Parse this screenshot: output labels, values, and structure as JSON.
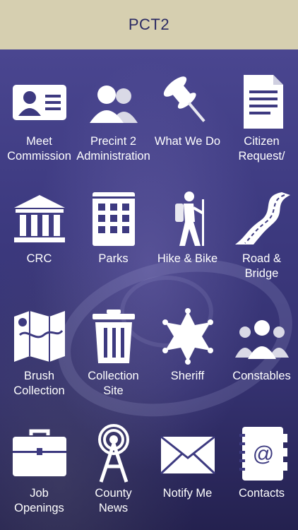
{
  "header": {
    "title": "PCT2"
  },
  "tiles": [
    {
      "label": "Meet\nCommission",
      "icon": "id-card-icon"
    },
    {
      "label": "Precint 2\nAdministration",
      "icon": "people-icon"
    },
    {
      "label": "What We Do",
      "icon": "pushpin-icon"
    },
    {
      "label": "Citizen\nRequest/",
      "icon": "document-icon"
    },
    {
      "label": "CRC",
      "icon": "courthouse-icon"
    },
    {
      "label": "Parks",
      "icon": "building-icon"
    },
    {
      "label": "Hike & Bike",
      "icon": "hiker-icon"
    },
    {
      "label": "Road &\nBridge",
      "icon": "road-icon"
    },
    {
      "label": "Brush\nCollection",
      "icon": "map-icon"
    },
    {
      "label": "Collection\nSite",
      "icon": "trash-can-icon"
    },
    {
      "label": "Sheriff",
      "icon": "star-badge-icon"
    },
    {
      "label": "Constables",
      "icon": "group-icon"
    },
    {
      "label": "Job\nOpenings",
      "icon": "briefcase-icon"
    },
    {
      "label": "County\nNews",
      "icon": "broadcast-tower-icon"
    },
    {
      "label": "Notify Me",
      "icon": "envelope-icon"
    },
    {
      "label": "Contacts",
      "icon": "address-book-icon"
    }
  ],
  "colors": {
    "header": "#d6cfb0",
    "header_text": "#2b2a63",
    "icon": "#ffffff"
  }
}
